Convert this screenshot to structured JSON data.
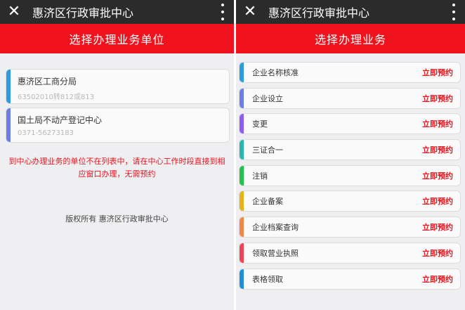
{
  "left": {
    "title": "惠济区行政审批中心",
    "banner": "选择办理业务单位",
    "units": [
      {
        "name": "惠济区工商分局",
        "phone": "63502010转812或813",
        "color": "#2e9be0"
      },
      {
        "name": "国土局不动产登记中心",
        "phone": "0371-56273183",
        "color": "#6c7ee6"
      }
    ],
    "notice": "到中心办理业务的单位不在列表中，请在中心工作时段直接到相应窗口办理，无需预约",
    "copyright": "版权所有 惠济区行政审批中心"
  },
  "right": {
    "title": "惠济区行政审批中心",
    "banner": "选择办理业务",
    "action_label": "立即预约",
    "items": [
      {
        "name": "企业名称核准",
        "action": "立即预约",
        "color": "#2e9be0"
      },
      {
        "name": "企业设立",
        "action": "立即预约",
        "color": "#6c7ee6"
      },
      {
        "name": "变更",
        "action": "立即预约",
        "color": "#8b5cf6"
      },
      {
        "name": "三证合一",
        "action": "立即预约",
        "color": "#2bb5b0"
      },
      {
        "name": "注销",
        "action": "立即预约",
        "color": "#22c24a"
      },
      {
        "name": "企业备案",
        "action": "立即预约",
        "color": "#e6b417"
      },
      {
        "name": "企业档案查询",
        "action": "立即预约",
        "color": "#f2864a"
      },
      {
        "name": "领取营业执照",
        "action": "立即预约",
        "color": "#f0445a"
      },
      {
        "name": "表格领取",
        "action": "立即预约",
        "color": "#1f8fd8"
      }
    ]
  },
  "icons": {
    "close": "close-icon",
    "menu": "more-vertical-icon"
  }
}
